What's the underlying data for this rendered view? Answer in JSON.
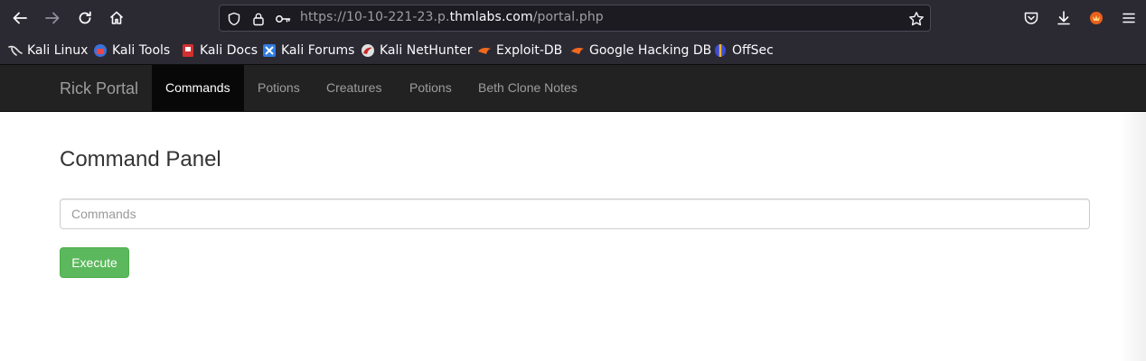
{
  "browser": {
    "url": {
      "prefix": "https://10-10-221-23.p.",
      "domain": "thmlabs.com",
      "path": "/portal.php"
    }
  },
  "bookmarks": [
    {
      "label": "Kali Linux",
      "icon": "kali-dragon-icon"
    },
    {
      "label": "Kali Tools",
      "icon": "kali-tools-icon"
    },
    {
      "label": "Kali Docs",
      "icon": "kali-docs-icon"
    },
    {
      "label": "Kali Forums",
      "icon": "kali-forums-icon"
    },
    {
      "label": "Kali NetHunter",
      "icon": "nethunter-icon"
    },
    {
      "label": "Exploit-DB",
      "icon": "exploit-db-icon"
    },
    {
      "label": "Google Hacking DB",
      "icon": "ghdb-icon"
    },
    {
      "label": "OffSec",
      "icon": "offsec-icon"
    }
  ],
  "navbar": {
    "brand": "Rick Portal",
    "items": [
      {
        "label": "Commands",
        "active": true
      },
      {
        "label": "Potions"
      },
      {
        "label": "Creatures"
      },
      {
        "label": "Potions"
      },
      {
        "label": "Beth Clone Notes"
      }
    ]
  },
  "main": {
    "title": "Command Panel",
    "command_input": {
      "placeholder": "Commands",
      "value": ""
    },
    "execute_label": "Execute"
  },
  "colors": {
    "navbar_bg": "#222222",
    "active_nav_bg": "#080808",
    "execute_button": "#5cb85c",
    "browser_chrome": "#2b2a33"
  }
}
